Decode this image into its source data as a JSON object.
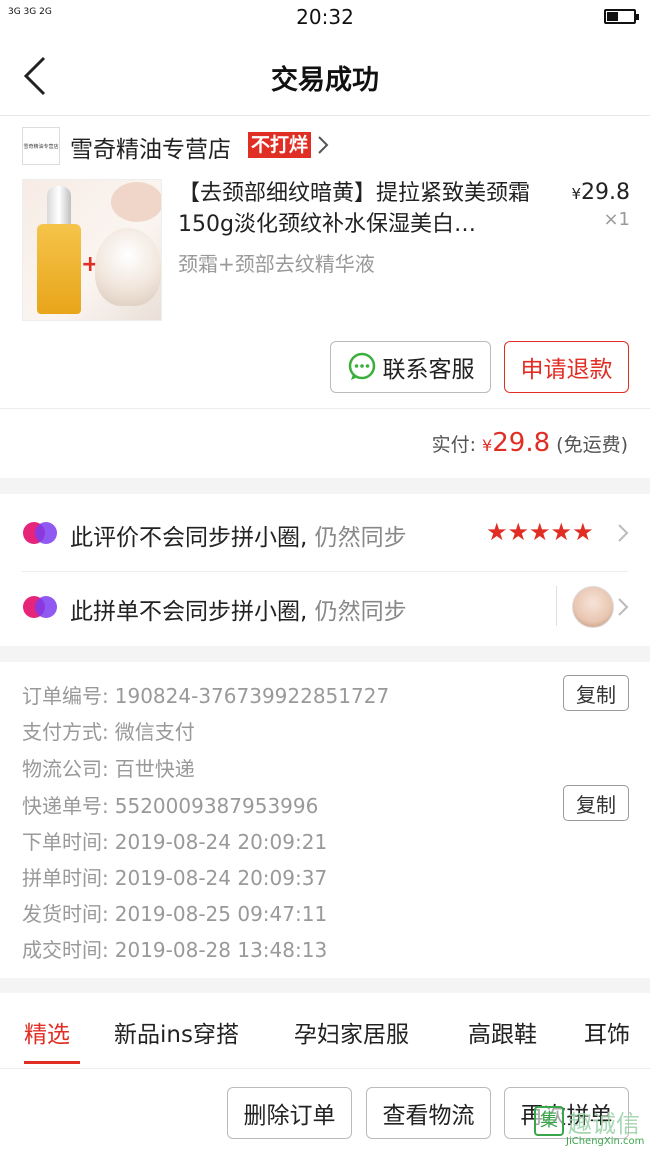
{
  "status_bar": {
    "signal": "3G 3G 2G",
    "time": "20:32"
  },
  "nav": {
    "title": "交易成功"
  },
  "shop": {
    "logo_text": "雪奇精油专营店",
    "name": "雪奇精油专营店",
    "badge": "不打烊"
  },
  "product": {
    "title": "【去颈部细纹暗黄】提拉紧致美颈霜150g淡化颈纹补水保湿美白…",
    "spec": "颈霜+颈部去纹精华液",
    "price_symbol": "¥",
    "price": "29.8",
    "quantity": "×1"
  },
  "actions": {
    "contact": "联系客服",
    "refund": "申请退款"
  },
  "payment": {
    "label": "实付:",
    "symbol": "¥",
    "amount": "29.8",
    "shipping": "(免运费)"
  },
  "sync": {
    "review_text": "此评价不会同步拼小圈,",
    "review_action": "仍然同步",
    "review_stars": "★★★★★",
    "order_text": "此拼单不会同步拼小圈,",
    "order_action": "仍然同步"
  },
  "order_info": {
    "copy_label": "复制",
    "rows": [
      {
        "label": "订单编号:",
        "value": "190824-376739922851727"
      },
      {
        "label": "支付方式:",
        "value": "微信支付"
      },
      {
        "label": "物流公司:",
        "value": "百世快递"
      },
      {
        "label": "快递单号:",
        "value": "5520009387953996"
      },
      {
        "label": "下单时间:",
        "value": "2019-08-24 20:09:21"
      },
      {
        "label": "拼单时间:",
        "value": "2019-08-24 20:09:37"
      },
      {
        "label": "发货时间:",
        "value": "2019-08-25 09:47:11"
      },
      {
        "label": "成交时间:",
        "value": "2019-08-28 13:48:13"
      }
    ]
  },
  "tabs": [
    "精选",
    "新品ins穿搭",
    "孕妇家居服",
    "高跟鞋",
    "耳饰"
  ],
  "bottom_buttons": {
    "delete": "删除订单",
    "logistics": "查看物流",
    "again": "再次拼单"
  },
  "watermark": {
    "cn": "趣诚信",
    "en": "JiChengXin.com",
    "icon": "集"
  },
  "colors": {
    "accent": "#e02e24",
    "muted": "#999999"
  }
}
